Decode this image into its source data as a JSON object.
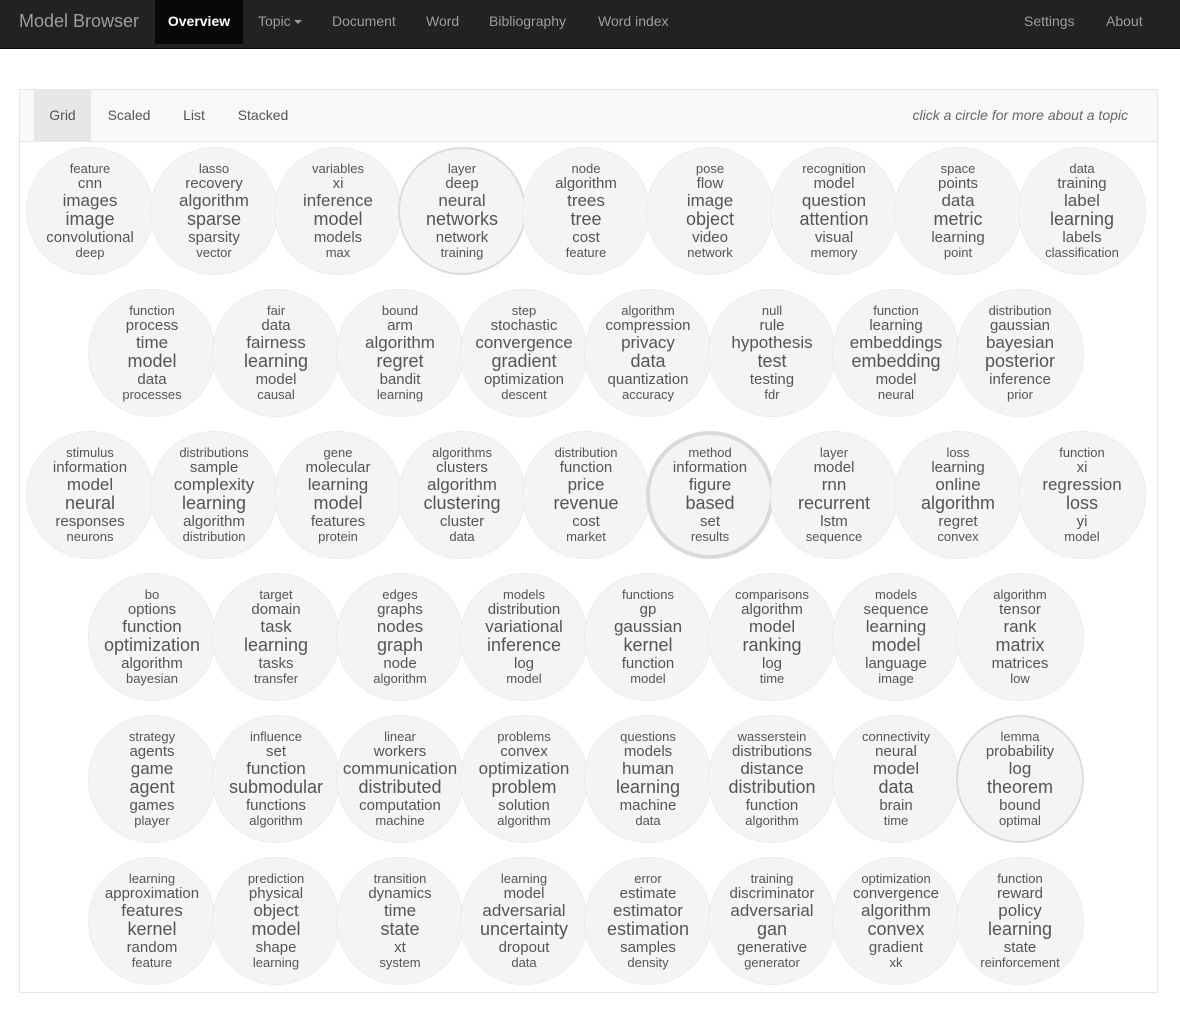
{
  "navbar": {
    "brand": "Model Browser",
    "items": [
      "Overview",
      "Topic",
      "Document",
      "Word",
      "Bibliography",
      "Word index"
    ],
    "right_items": [
      "Settings",
      "About"
    ]
  },
  "view_tabs": [
    "Grid",
    "Scaled",
    "List",
    "Stacked"
  ],
  "hint": "click a circle for more about a topic",
  "topics": [
    [
      "feature",
      "cnn",
      "images",
      "image",
      "convolutional",
      "deep"
    ],
    [
      "lasso",
      "recovery",
      "algorithm",
      "sparse",
      "sparsity",
      "vector"
    ],
    [
      "variables",
      "xi",
      "inference",
      "model",
      "models",
      "max"
    ],
    [
      "layer",
      "deep",
      "neural",
      "networks",
      "network",
      "training"
    ],
    [
      "node",
      "algorithm",
      "trees",
      "tree",
      "cost",
      "feature"
    ],
    [
      "pose",
      "flow",
      "image",
      "object",
      "video",
      "network"
    ],
    [
      "recognition",
      "model",
      "question",
      "attention",
      "visual",
      "memory"
    ],
    [
      "space",
      "points",
      "data",
      "metric",
      "learning",
      "point"
    ],
    [
      "data",
      "training",
      "label",
      "learning",
      "labels",
      "classification"
    ],
    [
      "function",
      "process",
      "time",
      "model",
      "data",
      "processes"
    ],
    [
      "fair",
      "data",
      "fairness",
      "learning",
      "model",
      "causal"
    ],
    [
      "bound",
      "arm",
      "algorithm",
      "regret",
      "bandit",
      "learning"
    ],
    [
      "step",
      "stochastic",
      "convergence",
      "gradient",
      "optimization",
      "descent"
    ],
    [
      "algorithm",
      "compression",
      "privacy",
      "data",
      "quantization",
      "accuracy"
    ],
    [
      "null",
      "rule",
      "hypothesis",
      "test",
      "testing",
      "fdr"
    ],
    [
      "function",
      "learning",
      "embeddings",
      "embedding",
      "model",
      "neural"
    ],
    [
      "distribution",
      "gaussian",
      "bayesian",
      "posterior",
      "inference",
      "prior"
    ],
    [
      "stimulus",
      "information",
      "model",
      "neural",
      "responses",
      "neurons"
    ],
    [
      "distributions",
      "sample",
      "complexity",
      "learning",
      "algorithm",
      "distribution"
    ],
    [
      "gene",
      "molecular",
      "learning",
      "model",
      "features",
      "protein"
    ],
    [
      "algorithms",
      "clusters",
      "algorithm",
      "clustering",
      "cluster",
      "data"
    ],
    [
      "distribution",
      "function",
      "price",
      "revenue",
      "cost",
      "market"
    ],
    [
      "method",
      "information",
      "figure",
      "based",
      "set",
      "results"
    ],
    [
      "layer",
      "model",
      "rnn",
      "recurrent",
      "lstm",
      "sequence"
    ],
    [
      "loss",
      "learning",
      "online",
      "algorithm",
      "regret",
      "convex"
    ],
    [
      "function",
      "xi",
      "regression",
      "loss",
      "yi",
      "model"
    ],
    [
      "bo",
      "options",
      "function",
      "optimization",
      "algorithm",
      "bayesian"
    ],
    [
      "target",
      "domain",
      "task",
      "learning",
      "tasks",
      "transfer"
    ],
    [
      "edges",
      "graphs",
      "nodes",
      "graph",
      "node",
      "algorithm"
    ],
    [
      "models",
      "distribution",
      "variational",
      "inference",
      "log",
      "model"
    ],
    [
      "functions",
      "gp",
      "gaussian",
      "kernel",
      "function",
      "model"
    ],
    [
      "comparisons",
      "algorithm",
      "model",
      "ranking",
      "log",
      "time"
    ],
    [
      "models",
      "sequence",
      "learning",
      "model",
      "language",
      "image"
    ],
    [
      "algorithm",
      "tensor",
      "rank",
      "matrix",
      "matrices",
      "low"
    ],
    [
      "strategy",
      "agents",
      "game",
      "agent",
      "games",
      "player"
    ],
    [
      "influence",
      "set",
      "function",
      "submodular",
      "functions",
      "algorithm"
    ],
    [
      "linear",
      "workers",
      "communication",
      "distributed",
      "computation",
      "machine"
    ],
    [
      "problems",
      "convex",
      "optimization",
      "problem",
      "solution",
      "algorithm"
    ],
    [
      "questions",
      "models",
      "human",
      "learning",
      "machine",
      "data"
    ],
    [
      "wasserstein",
      "distributions",
      "distance",
      "distribution",
      "function",
      "algorithm"
    ],
    [
      "connectivity",
      "neural",
      "model",
      "data",
      "brain",
      "time"
    ],
    [
      "lemma",
      "probability",
      "log",
      "theorem",
      "bound",
      "optimal"
    ],
    [
      "learning",
      "approximation",
      "features",
      "kernel",
      "random",
      "feature"
    ],
    [
      "prediction",
      "physical",
      "object",
      "model",
      "shape",
      "learning"
    ],
    [
      "transition",
      "dynamics",
      "time",
      "state",
      "xt",
      "system"
    ],
    [
      "learning",
      "model",
      "adversarial",
      "uncertainty",
      "dropout",
      "data"
    ],
    [
      "error",
      "estimate",
      "estimator",
      "estimation",
      "samples",
      "density"
    ],
    [
      "training",
      "discriminator",
      "adversarial",
      "gan",
      "generative",
      "generator"
    ],
    [
      "optimization",
      "convergence",
      "algorithm",
      "convex",
      "gradient",
      "xk"
    ],
    [
      "function",
      "reward",
      "policy",
      "learning",
      "state",
      "reinforcement"
    ]
  ]
}
